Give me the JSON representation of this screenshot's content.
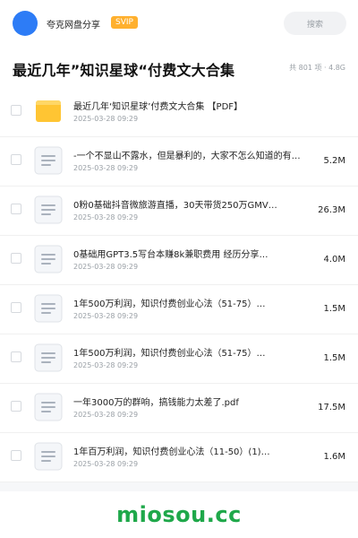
{
  "header": {
    "app_name": "夸克网盘分享",
    "badge": "SVIP",
    "search_placeholder": "搜索"
  },
  "folder": {
    "title": "最近几年”知识星球“付费文大合集",
    "meta": "共 801 项 · 4.8G"
  },
  "files": [
    {
      "type": "folder",
      "icon": "folder-icon",
      "name": "最近几年‘知识星球’付费文大合集 【PDF】",
      "date": "2025-03-28 09:29",
      "size": ""
    },
    {
      "type": "doc",
      "icon": "document-icon",
      "name": "-一个不显山不露水，但是暴利的，大家不怎么知道的有…",
      "date": "2025-03-28 09:29",
      "size": "5.2M"
    },
    {
      "type": "doc",
      "icon": "document-icon",
      "name": "0粉0基础抖音微旅游直播，30天带货250万GMV…",
      "date": "2025-03-28 09:29",
      "size": "26.3M"
    },
    {
      "type": "doc",
      "icon": "document-icon",
      "name": "0基础用GPT3.5写台本赚8k兼职费用 经历分享…",
      "date": "2025-03-28 09:29",
      "size": "4.0M"
    },
    {
      "type": "doc",
      "icon": "document-icon",
      "name": "1年500万利润，知识付费创业心法（51-75）…",
      "date": "2025-03-28 09:29",
      "size": "1.5M"
    },
    {
      "type": "doc",
      "icon": "document-icon",
      "name": "1年500万利润，知识付费创业心法（51-75）…",
      "date": "2025-03-28 09:29",
      "size": "1.5M"
    },
    {
      "type": "doc",
      "icon": "document-icon",
      "name": "一年3000万的群响，搞钱能力太差了.pdf",
      "date": "2025-03-28 09:29",
      "size": "17.5M"
    },
    {
      "type": "doc",
      "icon": "document-icon",
      "name": "1年百万利润，知识付费创业心法（11-50）(1)…",
      "date": "2025-03-28 09:29",
      "size": "1.6M"
    }
  ],
  "footer": {
    "brand": "miosou.cc"
  },
  "colors": {
    "accent": "#2d7cf6",
    "svip": "#ffb02e",
    "folder": "#ffc533",
    "brand": "#1fa84a"
  }
}
